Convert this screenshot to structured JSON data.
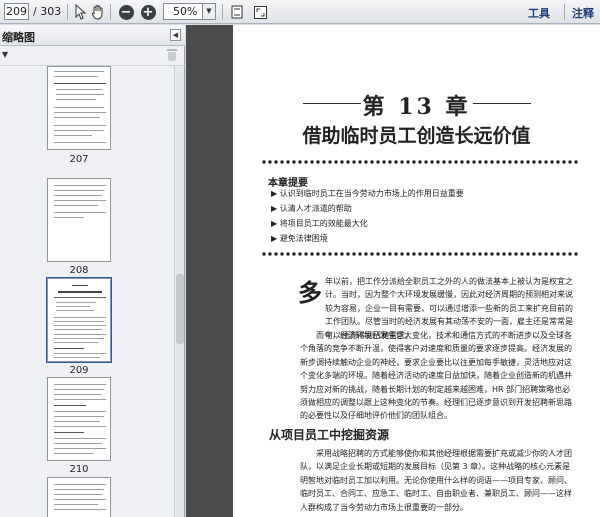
{
  "toolbar": {
    "page_current": "209",
    "page_total": "/ 303",
    "zoom": "50%",
    "tools_label": "工具",
    "comment_label": "注释"
  },
  "panel": {
    "title": "缩略图",
    "thumbnails": [
      {
        "label": "207"
      },
      {
        "label": "208"
      },
      {
        "label": "209"
      },
      {
        "label": "210"
      }
    ]
  },
  "document": {
    "chapter_number": "第 13 章",
    "chapter_title": "借助临时员工创造长远价值",
    "key_points_heading": "本章提要",
    "key_points": [
      "认识到临时员工在当今劳动力市场上的作用日益重要",
      "认清人才派遣的帮助",
      "将项目员工的效能最大化",
      "避免法律困境"
    ],
    "big_char": "多",
    "para1": "年以前，把工作分派给全职员工之外的人的做法基本上被认为是权宜之计。当时，因为整个大环境发展缓慢，因此对经济周期的预测相对来说较为容易，企业一目有需要，可以通过增添一些新的员工来扩充目前的工作团队。尽管当时的经济发展有其动荡不安的一面，雇主还是常常是可以预测得到招聘需求。",
    "para2": "而今，经济环境已发生巨大变化，技术和通信方式的不断进步以及全球各个角落的竞争不断升温，使得客户对速度和质量的要求逐步提高。经济发展的新步调持续触动企业的神经，要求企业要比以往更加每手敏捷，灵活地应对这个变化多端的环境。随着经济活动的速度日益加快，随着企业创造新的机遇并努力应对新的挑战，随着长期计划的制定越来越困难，HR 部门招聘策略也必须做相应的调整以跟上这种变化的节奏。经理们已逐步意识到开发招聘新思路的必要性以及仔细地评价他们的团队组合。",
    "section_heading": "从项目员工中挖掘资源",
    "para3": "采用战略招聘的方式能够使你和其他经理根据需要扩充或减少你的人才团队，以满足企业长期或短期的发展目标（见第 3 章）。这种战略的核心元素是明智地对临时员工加以利用。无论你使用什么样的词语——项目专家、顾问、临时员工、合同工、应急工、临时工、自由职业者、兼职员工、顾问——这样人群构成了当今劳动力市场上很重要的一部分。"
  }
}
